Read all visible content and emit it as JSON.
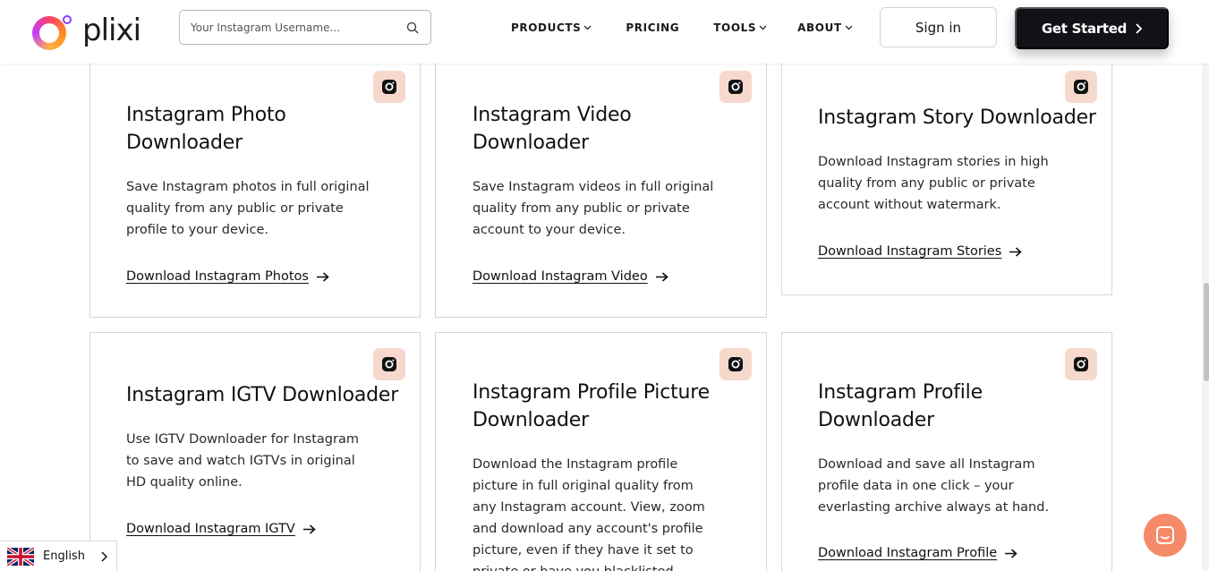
{
  "brand": {
    "name": "plixi"
  },
  "search": {
    "placeholder": "Your Instagram Username..."
  },
  "nav": {
    "products": "PRODUCTS",
    "pricing": "PRICING",
    "tools": "TOOLS",
    "about": "ABOUT"
  },
  "header_buttons": {
    "sign_in": "Sign in",
    "get_started": "Get Started"
  },
  "cards": [
    {
      "title": "Instagram Photo Downloader",
      "title_lines": [
        "Instagram Photo",
        "Downloader"
      ],
      "description": "Save Instagram photos in full original quality from any public or private profile to your device.",
      "desc_lines": [
        "Save Instagram photos in full original",
        "quality from any public or private",
        "profile to your device."
      ],
      "link": "Download Instagram Photos"
    },
    {
      "title": "Instagram Video Downloader",
      "title_lines": [
        "Instagram Video",
        "Downloader"
      ],
      "description": "Save Instagram videos in full original quality from any public or private account to your device.",
      "desc_lines": [
        "Save Instagram videos in full original",
        "quality from any public or private",
        "account to your device."
      ],
      "link": "Download Instagram Video"
    },
    {
      "title": "Instagram Story Downloader",
      "title_lines": [
        "Instagram Story Downloader"
      ],
      "description": "Download Instagram stories in high quality from any public or private account without watermark.",
      "desc_lines": [
        "Download Instagram stories in high",
        "quality from any public or private",
        "account without watermark."
      ],
      "link": "Download Instagram Stories"
    },
    {
      "title": "Instagram IGTV Downloader",
      "title_lines": [
        "Instagram IGTV Downloader"
      ],
      "description": "Use IGTV Downloader for Instagram to save and watch IGTVs in original HD quality online.",
      "desc_lines": [
        "Use IGTV Downloader for Instagram",
        "to save and watch IGTVs in original",
        "HD quality online."
      ],
      "link": "Download Instagram IGTV"
    },
    {
      "title": "Instagram Profile Picture Downloader",
      "title_lines": [
        "Instagram Profile Picture",
        "Downloader"
      ],
      "description": "Download the Instagram profile picture in full original quality from any Instagram account. View, zoom and download any account's profile picture, even if they have it set to private or have you blacklisted.",
      "desc_lines": [
        "Download the Instagram profile",
        "picture in full original quality from",
        "any Instagram account. View, zoom",
        "and download any account's profile",
        "picture, even if they have it set to",
        "private or have you blacklisted."
      ],
      "link": ""
    },
    {
      "title": "Instagram Profile Downloader",
      "title_lines": [
        "Instagram Profile",
        "Downloader"
      ],
      "description": "Download and save all Instagram profile data in one click – your everlasting archive always at hand.",
      "desc_lines": [
        "Download and save all Instagram",
        "profile data in one click – your",
        "everlasting archive always at hand."
      ],
      "link": "Download Instagram Profile"
    }
  ],
  "language": {
    "label": "English"
  },
  "colors": {
    "accent_bg": "#f7d8cc",
    "button_dark": "#111217",
    "chat": "#f58a68"
  },
  "icons": [
    "search-icon",
    "chevron-down-icon",
    "chevron-right-icon",
    "instagram-icon",
    "arrow-right-icon",
    "uk-flag-icon",
    "chat-icon"
  ]
}
